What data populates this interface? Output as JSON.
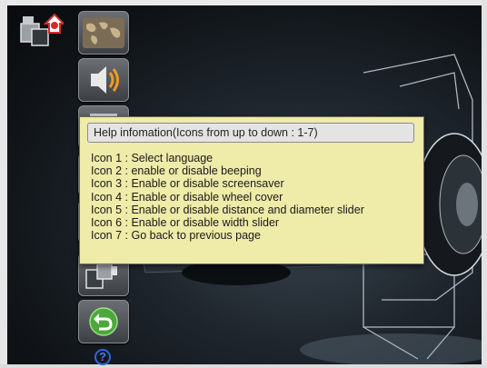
{
  "sidebar": {
    "buttons": [
      {
        "icon": "world-map-icon"
      },
      {
        "icon": "speaker-icon"
      },
      {
        "icon": "screensaver-icon"
      },
      {
        "icon": "wheel-cover-icon"
      },
      {
        "icon": "distance-diameter-slider-icon"
      },
      {
        "icon": "width-slider-icon"
      },
      {
        "icon": "back-arrow-icon"
      }
    ]
  },
  "help_dialog": {
    "title": "Help infomation(Icons from up to down : 1-7)",
    "items": [
      "Icon 1 : Select language",
      "Icon 2 : enable or disable beeping",
      "Icon 3 : Enable or disable screensaver",
      "Icon 4 : Enable or disable wheel cover",
      "Icon 5 : Enable or disable distance and diameter slider",
      "Icon 6 : Enable or disable width slider",
      "Icon 7 : Go back to previous page"
    ]
  },
  "help_button": {
    "glyph": "?"
  },
  "colors": {
    "dialog_bg": "#efeba8",
    "help_icon": "#2f66d8",
    "speaker_wave": "#f39a1e",
    "back_button": "#4ca83a",
    "home_red": "#d62b2b"
  }
}
